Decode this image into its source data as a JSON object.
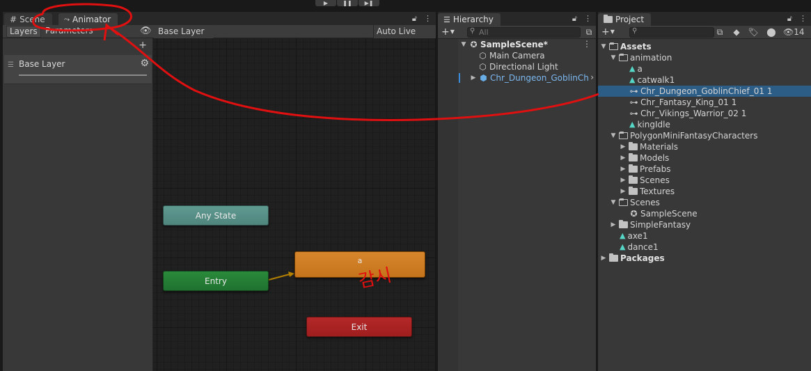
{
  "play_controls": [
    "▶",
    "❚❚",
    "▶❚"
  ],
  "animator": {
    "tabs": [
      {
        "label": "Scene",
        "icon": "grid-icon"
      },
      {
        "label": "Animator",
        "icon": "animator-icon"
      }
    ],
    "toolbar": {
      "layers_label": "Layers",
      "parameters_label": "Parameters",
      "breadcrumb": "Base Layer",
      "auto_live_link": "Auto Live Link"
    },
    "layers": [
      {
        "name": "Base Layer"
      }
    ],
    "nodes": {
      "any_state": "Any State",
      "entry": "Entry",
      "state_a": "a",
      "exit": "Exit"
    },
    "colors": {
      "any_state": "#5a9189",
      "entry": "#217a34",
      "default_state": "#d17e25",
      "exit": "#aa2222"
    }
  },
  "hierarchy": {
    "tab_label": "Hierarchy",
    "search_placeholder": "All",
    "scene": "SampleScene*",
    "items": [
      "Main Camera",
      "Directional Light",
      "Chr_Dungeon_GoblinCh"
    ]
  },
  "project": {
    "tab_label": "Project",
    "hidden_count": "14",
    "tree": {
      "assets": "Assets",
      "animation": "animation",
      "animation_items": [
        "a",
        "catwalk1",
        "Chr_Dungeon_GoblinChief_01 1",
        "Chr_Fantasy_King_01 1",
        "Chr_Vikings_Warrior_02 1",
        "kingIdle"
      ],
      "polygon": "PolygonMiniFantasyCharacters",
      "polygon_items": [
        "Materials",
        "Models",
        "Prefabs",
        "Scenes",
        "Textures"
      ],
      "scenes": "Scenes",
      "scene_item": "SampleScene",
      "simple_fantasy": "SimpleFantasy",
      "root_anims": [
        "axe1",
        "dance1"
      ],
      "packages": "Packages"
    },
    "selected_item": "Chr_Dungeon_GoblinChief_01 1"
  },
  "annotation": {
    "color": "#e01010",
    "handwritten_text": "감시"
  }
}
